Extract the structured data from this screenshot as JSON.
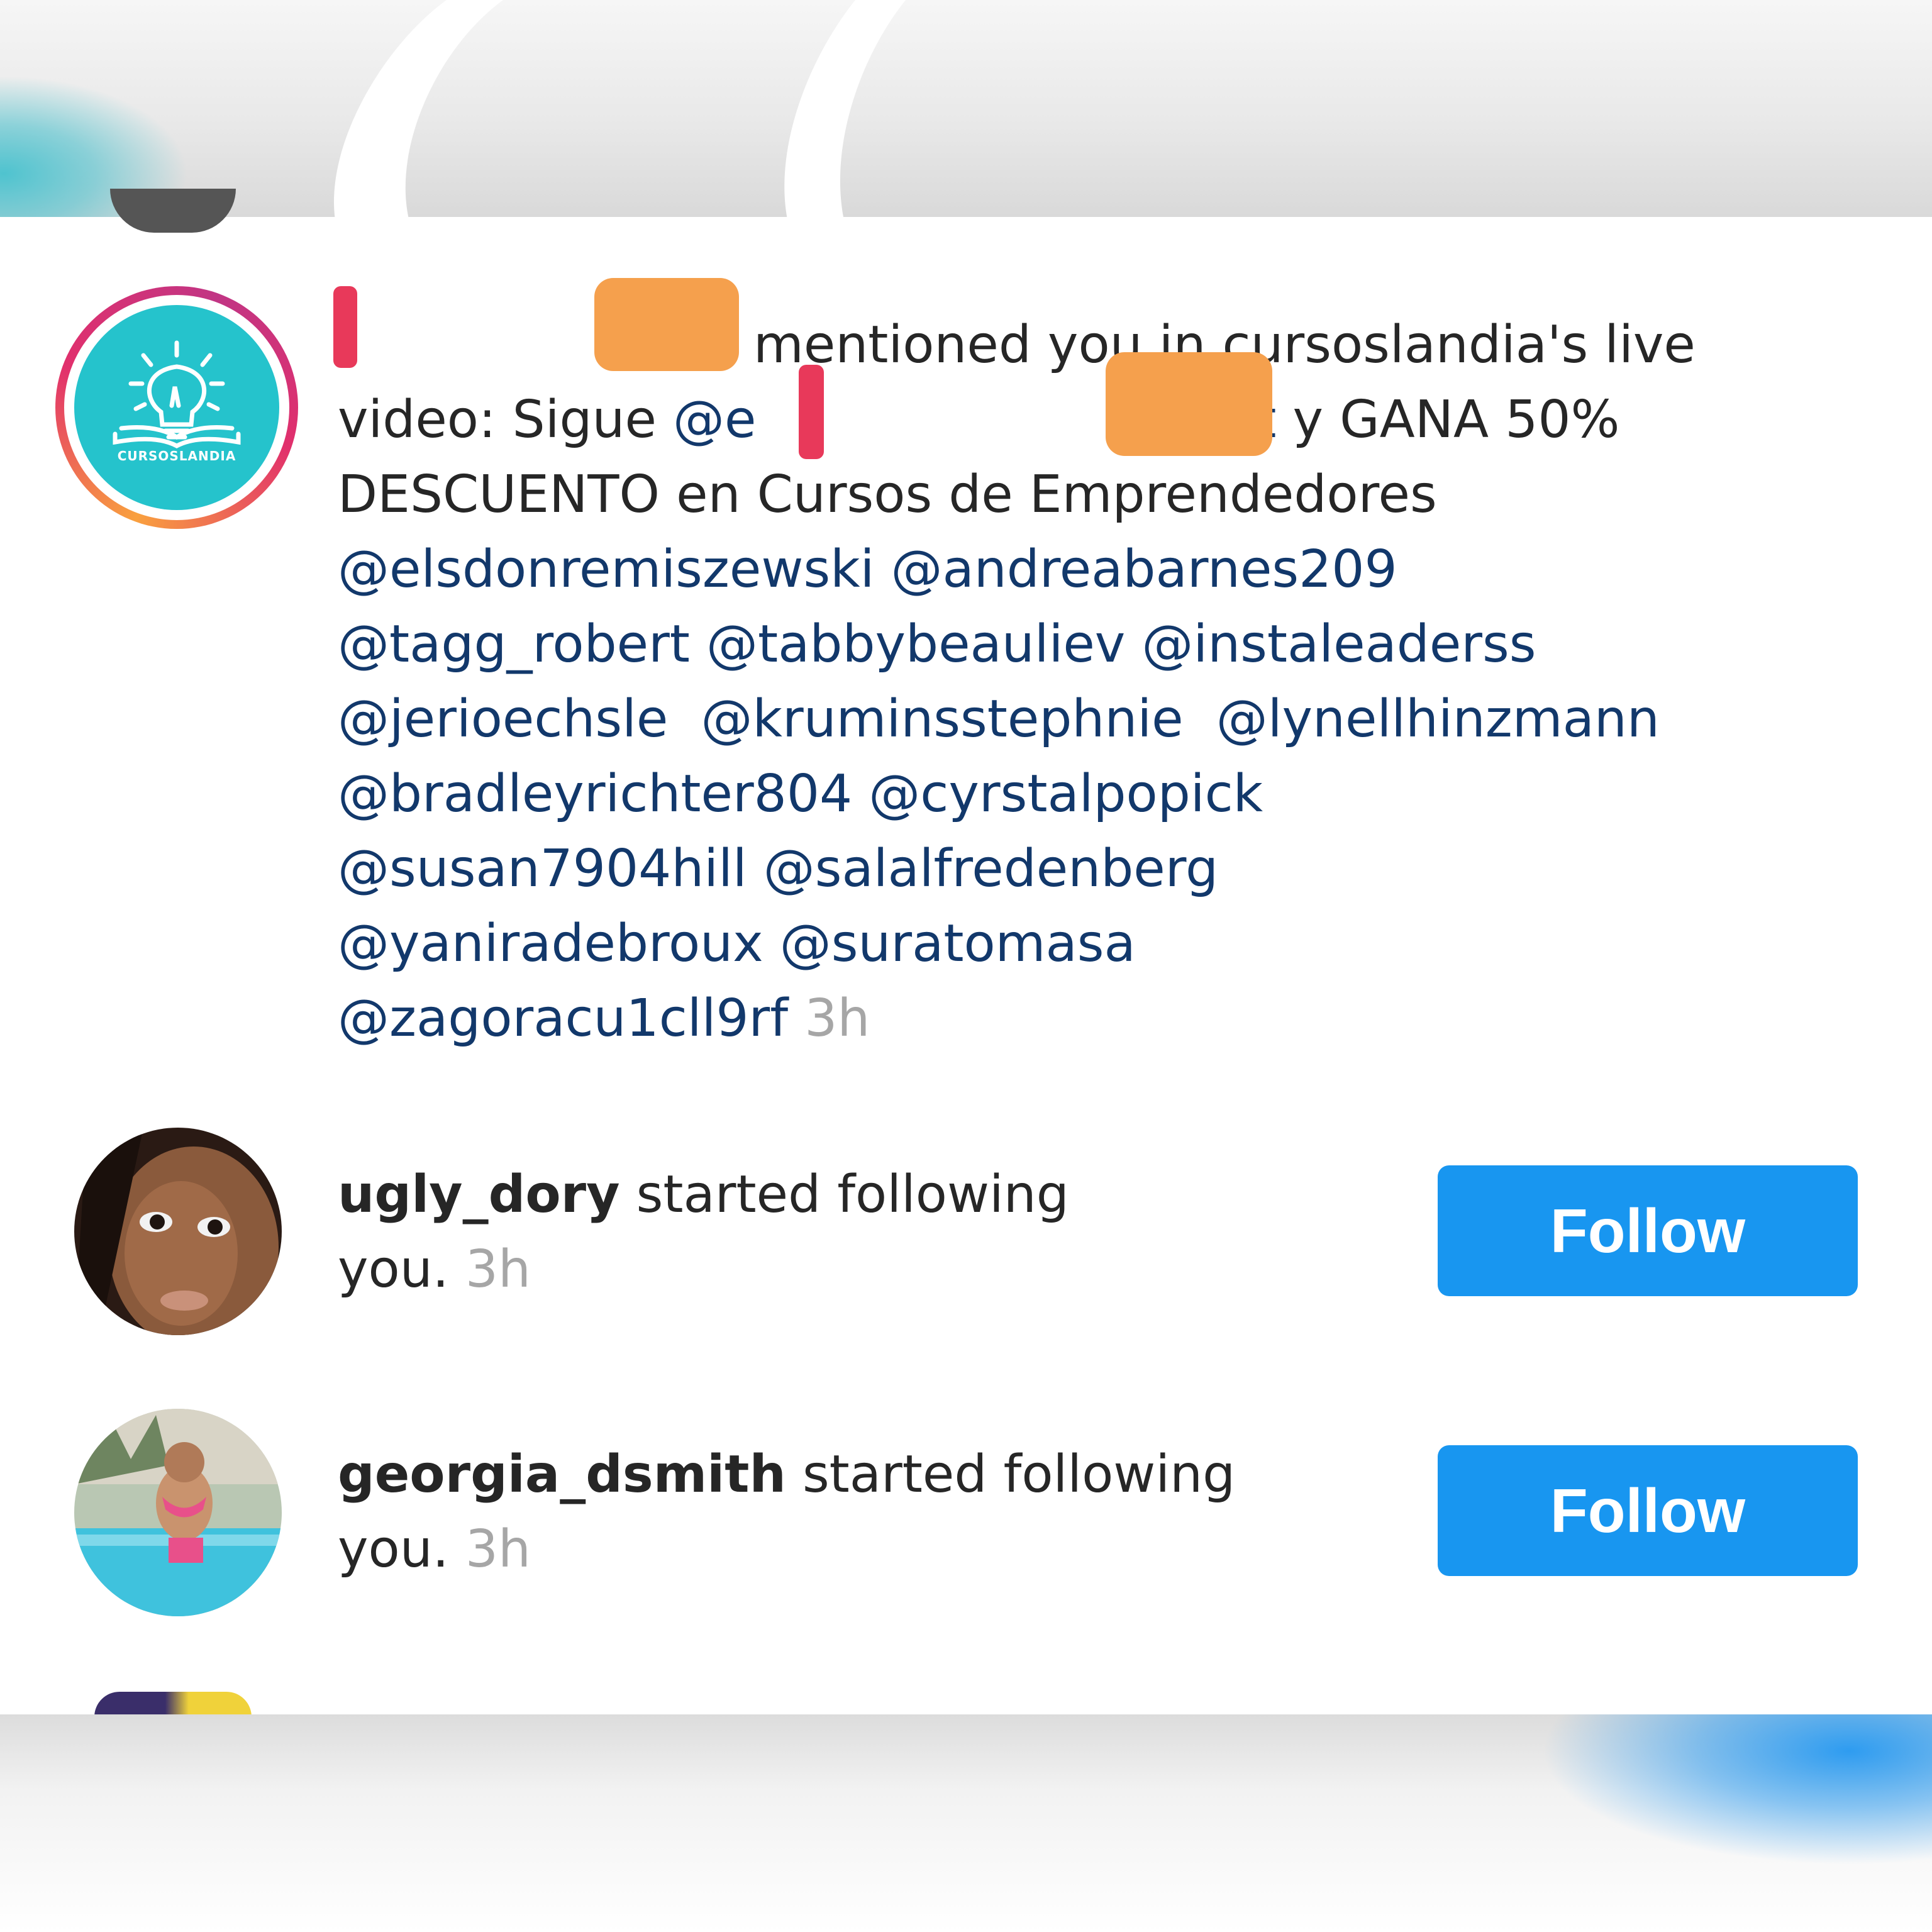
{
  "mention": {
    "logo_text": "CURSOSLANDIA",
    "line1_text": "mentioned you in cursoslandia's live",
    "line2_prefix": "video: Sigue ",
    "line2_link_start": "@e",
    "line2_link_end": "int",
    "line2_suffix": " y GANA 50%",
    "line3": "DESCUENTO en Cursos de Emprendedores",
    "tags_rows": [
      [
        "@elsdonremiszewski",
        "@andreabarnes209"
      ],
      [
        "@tagg_robert",
        "@tabbybeauliev",
        "@instaleaderss"
      ],
      [
        "@jerioechsle",
        "@kruminsstephnie",
        "@lynellhinzmann"
      ],
      [
        "@bradleyrichter804",
        "@cyrstalpopick"
      ],
      [
        "@susan7904hill",
        "@salalfredenberg"
      ],
      [
        "@yaniradebroux",
        "@suratomasa"
      ],
      [
        "@zagoracu1cll9rf"
      ]
    ],
    "time": "3h"
  },
  "follows": [
    {
      "username": "ugly_dory",
      "action": "started following",
      "line2": "you.",
      "time": "3h",
      "button_label": "Follow"
    },
    {
      "username": "georgia_dsmith",
      "action": "started following",
      "line2": "you.",
      "time": "3h",
      "button_label": "Follow"
    }
  ],
  "colors": {
    "follow_button": "#1896f0",
    "link": "#12386b",
    "time": "#a6a6a6",
    "logo_bg": "#25c3cc"
  }
}
